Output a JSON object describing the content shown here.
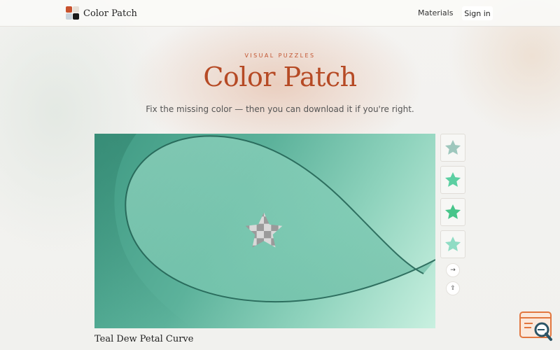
{
  "header": {
    "brand": "Color Patch",
    "nav_materials": "Materials",
    "signin": "Sign in"
  },
  "hero": {
    "eyebrow": "VISUAL PUZZLES",
    "title": "Color Patch",
    "subtitle": "Fix the missing color — then you can download it if you're right."
  },
  "puzzle": {
    "caption": "Teal Dew Petal Curve",
    "missing_patch_icon": "star-icon",
    "options": [
      {
        "icon": "star-icon",
        "color": "#9ec7bd"
      },
      {
        "icon": "star-icon",
        "color": "#5ccfa2"
      },
      {
        "icon": "star-icon",
        "color": "#47c58a"
      },
      {
        "icon": "star-icon",
        "color": "#8fdcc4"
      }
    ],
    "actions": [
      {
        "icon": "arrow-right-icon",
        "glyph": "→"
      },
      {
        "icon": "share-icon",
        "glyph": "⇪"
      }
    ]
  },
  "colors": {
    "accent": "#b64a25",
    "eyebrow": "#c25531"
  }
}
